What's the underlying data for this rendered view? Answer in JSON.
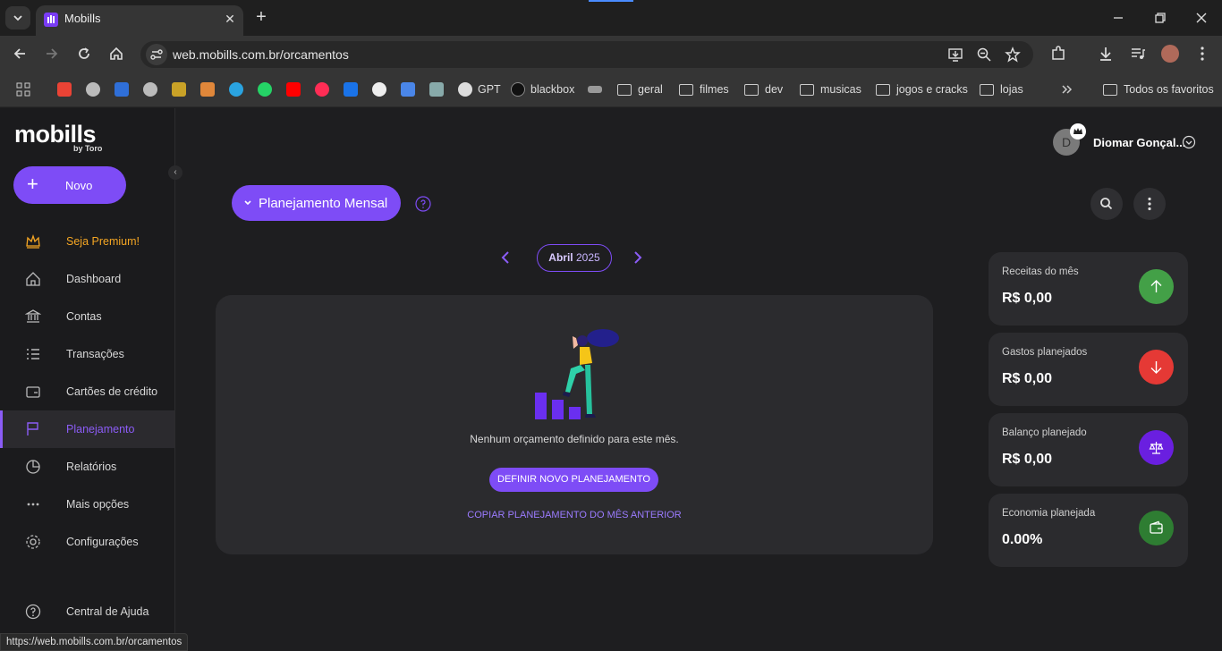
{
  "browser": {
    "tab_title": "Mobills",
    "url": "web.mobills.com.br/orcamentos",
    "bookmarks": [
      "GPT",
      "blackbox",
      "geral",
      "filmes",
      "dev",
      "musicas",
      "jogos e cracks",
      "lojas"
    ],
    "all_bookmarks": "Todos os favoritos"
  },
  "sidebar": {
    "logo": "mobills",
    "logo_sub": "by Toro",
    "new_button": "Novo",
    "items": [
      {
        "label": "Seja Premium!",
        "icon": "crown-icon"
      },
      {
        "label": "Dashboard",
        "icon": "home-icon"
      },
      {
        "label": "Contas",
        "icon": "bank-icon"
      },
      {
        "label": "Transações",
        "icon": "list-icon"
      },
      {
        "label": "Cartões de crédito",
        "icon": "credit-card-icon"
      },
      {
        "label": "Planejamento",
        "icon": "flag-icon"
      },
      {
        "label": "Relatórios",
        "icon": "pie-chart-icon"
      },
      {
        "label": "Mais opções",
        "icon": "more-dots-icon"
      },
      {
        "label": "Configurações",
        "icon": "gear-icon"
      },
      {
        "label": "Central de Ajuda",
        "icon": "help-circle-icon"
      }
    ]
  },
  "user": {
    "initial": "D",
    "name": "Diomar Gonçal..."
  },
  "header": {
    "planning_button": "Planejamento Mensal"
  },
  "month": {
    "name": "Abril",
    "year": "2025"
  },
  "empty_state": {
    "message": "Nenhum orçamento definido para este mês.",
    "define_button": "DEFINIR NOVO PLANEJAMENTO",
    "copy_link": "COPIAR PLANEJAMENTO DO MÊS ANTERIOR"
  },
  "summary": [
    {
      "label": "Receitas do mês",
      "value": "R$ 0,00",
      "color": "#43a047"
    },
    {
      "label": "Gastos planejados",
      "value": "R$ 0,00",
      "color": "#e53935"
    },
    {
      "label": "Balanço planejado",
      "value": "R$ 0,00",
      "color": "#6a1fe0"
    },
    {
      "label": "Economia planejada",
      "value": "0.00%",
      "color": "#2e7d32"
    }
  ],
  "status_bar": "https://web.mobills.com.br/orcamentos",
  "colors": {
    "accent": "#7e4cf6",
    "premium": "#f5a623"
  }
}
